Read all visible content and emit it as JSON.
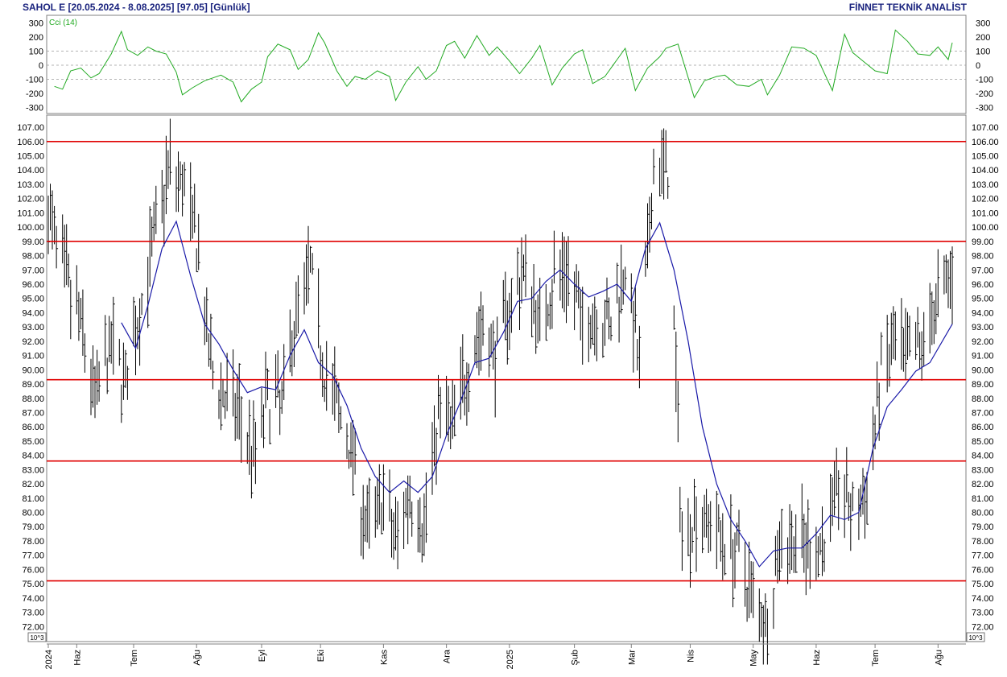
{
  "header": {
    "title": "SAHOL E  [20.05.2024 - 8.08.2025]  [97.05]  [Günlük]",
    "provider": "FİNNET TEKNİK ANALİST"
  },
  "colors": {
    "price_bars": "#000000",
    "moving_average": "#1a1aa8",
    "support_resistance": "#e00000",
    "cci": "#22aa22",
    "axis_text": "#000000",
    "header_text": "#1a237e"
  },
  "chart_data": [
    {
      "type": "line",
      "title": "Cci (14)",
      "ylim": [
        -300,
        300
      ],
      "y_ticks": [
        "300",
        "200",
        "100",
        "0",
        "-100",
        "-200",
        "-300"
      ],
      "grid": "dashed at -100, 0 and 100",
      "x_dates": [
        "2024-05-23",
        "2024-05-27",
        "2024-05-31",
        "2024-06-05",
        "2024-06-10",
        "2024-06-14",
        "2024-06-20",
        "2024-06-25",
        "2024-06-28",
        "2024-07-03",
        "2024-07-08",
        "2024-07-12",
        "2024-07-17",
        "2024-07-22",
        "2024-07-25",
        "2024-07-30",
        "2024-08-05",
        "2024-08-09",
        "2024-08-13",
        "2024-08-19",
        "2024-08-23",
        "2024-08-28",
        "2024-09-02",
        "2024-09-05",
        "2024-09-10",
        "2024-09-16",
        "2024-09-20",
        "2024-09-25",
        "2024-09-30",
        "2024-10-03",
        "2024-10-09",
        "2024-10-14",
        "2024-10-18",
        "2024-10-23",
        "2024-10-29",
        "2024-11-04",
        "2024-11-07",
        "2024-11-12",
        "2024-11-18",
        "2024-11-22",
        "2024-11-27",
        "2024-12-02",
        "2024-12-06",
        "2024-12-11",
        "2024-12-17",
        "2024-12-23",
        "2024-12-27",
        "2025-01-02",
        "2025-01-07",
        "2025-01-13",
        "2025-01-17",
        "2025-01-23",
        "2025-01-28",
        "2025-02-03",
        "2025-02-07",
        "2025-02-12",
        "2025-02-18",
        "2025-02-24",
        "2025-02-28",
        "2025-03-05",
        "2025-03-11",
        "2025-03-17",
        "2025-03-20",
        "2025-03-26",
        "2025-04-03",
        "2025-04-08",
        "2025-04-14",
        "2025-04-18",
        "2025-04-24",
        "2025-04-30",
        "2025-05-06",
        "2025-05-09",
        "2025-05-15",
        "2025-05-21",
        "2025-05-27",
        "2025-06-02",
        "2025-06-10",
        "2025-06-16",
        "2025-06-20",
        "2025-06-25",
        "2025-07-01",
        "2025-07-07",
        "2025-07-11",
        "2025-07-17",
        "2025-07-22",
        "2025-07-28",
        "2025-08-01",
        "2025-08-06",
        "2025-08-08"
      ],
      "values": [
        -150,
        -170,
        -40,
        -20,
        -90,
        -60,
        80,
        240,
        110,
        70,
        130,
        100,
        80,
        -50,
        -210,
        -160,
        -110,
        -90,
        -70,
        -120,
        -260,
        -170,
        -120,
        60,
        150,
        110,
        -30,
        40,
        230,
        160,
        -40,
        -150,
        -80,
        -100,
        -40,
        -80,
        -250,
        -120,
        -10,
        -100,
        -40,
        140,
        170,
        50,
        210,
        70,
        130,
        30,
        -60,
        50,
        140,
        -140,
        -20,
        80,
        110,
        -130,
        -80,
        40,
        120,
        -180,
        -20,
        60,
        120,
        150,
        -230,
        -110,
        -80,
        -70,
        -140,
        -150,
        -100,
        -210,
        -70,
        130,
        120,
        70,
        -180,
        220,
        90,
        30,
        -40,
        -60,
        250,
        170,
        80,
        70,
        130,
        40,
        160,
        180,
        140
      ]
    },
    {
      "type": "bar",
      "subtype": "ohlc-high-low",
      "title": "",
      "ylim": [
        71,
        107.5
      ],
      "y_ticks": [
        "107.00",
        "106.00",
        "105.00",
        "104.00",
        "103.00",
        "102.00",
        "101.00",
        "100.00",
        "99.00",
        "98.00",
        "97.00",
        "96.00",
        "95.00",
        "94.00",
        "93.00",
        "92.00",
        "91.00",
        "90.00",
        "89.00",
        "88.00",
        "87.00",
        "86.00",
        "85.00",
        "84.00",
        "83.00",
        "82.00",
        "81.00",
        "80.00",
        "79.00",
        "78.00",
        "77.00",
        "76.00",
        "75.00",
        "74.00",
        "73.00",
        "72.00",
        "71.00"
      ],
      "x_tick_labels": [
        "2024",
        "Haz",
        "Tem",
        "Ağu",
        "Eyl",
        "Eki",
        "Kas",
        "Ara",
        "2025",
        "Şub",
        "Mar",
        "Nis",
        "May",
        "Haz",
        "Tem",
        "Ağu"
      ],
      "x_tick_dates": [
        "2024-05-20",
        "2024-06-03",
        "2024-07-01",
        "2024-08-01",
        "2024-09-02",
        "2024-10-01",
        "2024-11-01",
        "2024-12-02",
        "2025-01-02",
        "2025-02-03",
        "2025-03-03",
        "2025-04-01",
        "2025-05-02",
        "2025-06-02",
        "2025-07-01",
        "2025-08-01"
      ],
      "scale_note": "10^3",
      "last_close": 97.05,
      "date_range": [
        "2024-05-20",
        "2025-08-08"
      ],
      "horizontal_levels": [
        106.0,
        99.0,
        89.3,
        83.6,
        75.2
      ],
      "price_path_dates": [
        "2024-05-20",
        "2024-05-27",
        "2024-06-05",
        "2024-06-12",
        "2024-06-20",
        "2024-06-27",
        "2024-07-04",
        "2024-07-11",
        "2024-07-18",
        "2024-07-25",
        "2024-08-01",
        "2024-08-08",
        "2024-08-15",
        "2024-08-22",
        "2024-08-29",
        "2024-09-05",
        "2024-09-12",
        "2024-09-19",
        "2024-09-26",
        "2024-10-03",
        "2024-10-10",
        "2024-10-17",
        "2024-10-24",
        "2024-10-31",
        "2024-11-07",
        "2024-11-14",
        "2024-11-21",
        "2024-11-28",
        "2024-12-05",
        "2024-12-12",
        "2024-12-19",
        "2024-12-26",
        "2025-01-03",
        "2025-01-10",
        "2025-01-17",
        "2025-01-24",
        "2025-01-31",
        "2025-02-07",
        "2025-02-14",
        "2025-02-21",
        "2025-02-28",
        "2025-03-07",
        "2025-03-14",
        "2025-03-21",
        "2025-03-28",
        "2025-04-04",
        "2025-04-11",
        "2025-04-18",
        "2025-04-25",
        "2025-05-02",
        "2025-05-09",
        "2025-05-16",
        "2025-05-23",
        "2025-05-30",
        "2025-06-06",
        "2025-06-13",
        "2025-06-20",
        "2025-06-27",
        "2025-07-04",
        "2025-07-11",
        "2025-07-18",
        "2025-07-25",
        "2025-08-01",
        "2025-08-08"
      ],
      "price_path_values": [
        101,
        97,
        93,
        88,
        91.5,
        89,
        94,
        99,
        104,
        103,
        99,
        90,
        88,
        87,
        84,
        88,
        87.5,
        94,
        97,
        90,
        87,
        84,
        78.5,
        81,
        78,
        81.5,
        79,
        87,
        86,
        90,
        93,
        91,
        95,
        97,
        93,
        96.5,
        97,
        93,
        94,
        93,
        97.5,
        90,
        104,
        104,
        78,
        80,
        79.5,
        78,
        77,
        74,
        72.5,
        78.5,
        78,
        77.5,
        78,
        82,
        80,
        81,
        90,
        91.5,
        90.5,
        92,
        95,
        97
      ]
    },
    {
      "type": "line",
      "name": "",
      "role": "moving-average overlay on price panel",
      "x_dates": [
        "2024-06-25",
        "2024-07-02",
        "2024-07-08",
        "2024-07-15",
        "2024-07-22",
        "2024-07-29",
        "2024-08-05",
        "2024-08-12",
        "2024-08-19",
        "2024-08-26",
        "2024-09-02",
        "2024-09-09",
        "2024-09-16",
        "2024-09-23",
        "2024-09-30",
        "2024-10-07",
        "2024-10-14",
        "2024-10-21",
        "2024-10-28",
        "2024-11-04",
        "2024-11-11",
        "2024-11-18",
        "2024-11-25",
        "2024-12-02",
        "2024-12-09",
        "2024-12-16",
        "2024-12-23",
        "2024-12-30",
        "2025-01-06",
        "2025-01-13",
        "2025-01-20",
        "2025-01-27",
        "2025-02-03",
        "2025-02-10",
        "2025-02-17",
        "2025-02-24",
        "2025-03-03",
        "2025-03-10",
        "2025-03-17",
        "2025-03-24",
        "2025-03-31",
        "2025-04-07",
        "2025-04-14",
        "2025-04-21",
        "2025-04-28",
        "2025-05-05",
        "2025-05-12",
        "2025-05-19",
        "2025-05-26",
        "2025-06-02",
        "2025-06-09",
        "2025-06-16",
        "2025-06-23",
        "2025-06-30",
        "2025-07-07",
        "2025-07-14",
        "2025-07-21",
        "2025-07-28",
        "2025-08-08"
      ],
      "values": [
        93.3,
        91.5,
        94.5,
        98.5,
        100.4,
        96.6,
        93.2,
        91.8,
        90,
        88.4,
        88.8,
        88.6,
        91,
        92.8,
        90.5,
        89.6,
        87.5,
        84.5,
        82.5,
        81.4,
        82.2,
        81.4,
        82.5,
        85.4,
        87.8,
        90.5,
        90.8,
        92.6,
        94.8,
        95,
        96.2,
        97,
        96,
        95.1,
        95.5,
        96,
        94.8,
        98.5,
        100.3,
        97,
        92,
        86,
        82,
        79.5,
        78,
        76.2,
        77.3,
        77.5,
        77.5,
        78.5,
        79.8,
        79.5,
        80,
        84.5,
        87.4,
        88.6,
        89.9,
        90.5,
        93.2
      ]
    }
  ]
}
